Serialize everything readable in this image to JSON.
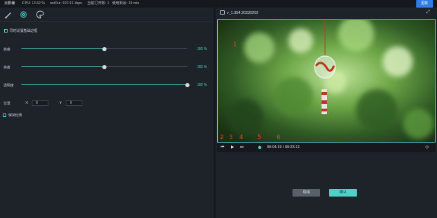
{
  "topbar": {
    "app_name": "云影编",
    "cpu": "CPU: 13.62 %",
    "net": "netOut: 937.91 kbps",
    "windows": "当前打开数: 1",
    "remaining": "使用剩余: 19 min",
    "update_label": "更新"
  },
  "toolbar": {
    "icons": [
      "brush-icon",
      "gear-icon",
      "palette-icon"
    ]
  },
  "left_panel": {
    "sync_checkbox_label": "同时设置基础边框",
    "sliders": [
      {
        "label": "亮度",
        "value": 0.5,
        "value_text": "100 %"
      },
      {
        "label": "亮度",
        "value": 0.5,
        "value_text": "100 %"
      },
      {
        "label": "透明度",
        "value": 1.0,
        "value_text": "100 %"
      }
    ],
    "position": {
      "label": "位置",
      "x_label": "X",
      "x_value": "0",
      "y_label": "Y",
      "y_value": "0"
    },
    "keep_ratio_label": "保持比例"
  },
  "preview": {
    "file_name": "v_1.354.20230202",
    "timecode": "00:04.19 / 00:23.12",
    "annotations": [
      "1",
      "2",
      "3",
      "4",
      "5",
      "6"
    ],
    "accent_color": "#4ed1c6",
    "annotation_color": "#d9492e"
  },
  "dialog": {
    "cancel_label": "取消",
    "confirm_label": "确认"
  }
}
